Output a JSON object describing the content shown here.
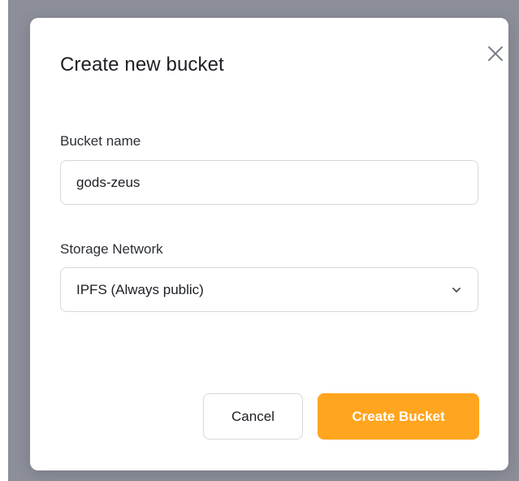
{
  "dialog": {
    "title": "Create new bucket",
    "close_icon": "close-icon"
  },
  "form": {
    "bucket_name": {
      "label": "Bucket name",
      "value": "gods-zeus"
    },
    "storage_network": {
      "label": "Storage Network",
      "selected": "IPFS (Always public)",
      "icon": "chevron-down-icon"
    }
  },
  "actions": {
    "cancel_label": "Cancel",
    "create_label": "Create Bucket"
  },
  "colors": {
    "accent": "#ffa51f",
    "backdrop": "#8c8f99",
    "border": "#d5d8de"
  }
}
